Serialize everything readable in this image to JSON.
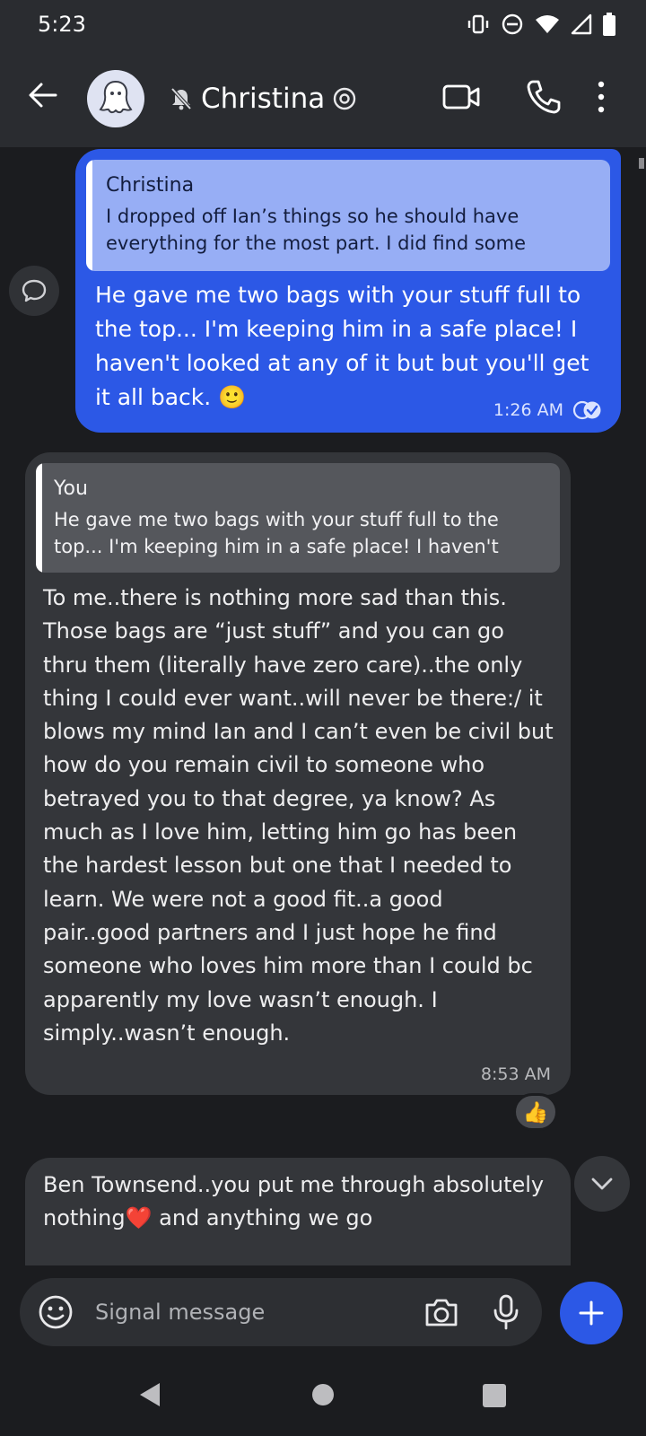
{
  "status_bar": {
    "time": "5:23",
    "icons": [
      "vibrate-icon",
      "dnd-icon",
      "wifi-icon",
      "signal-icon",
      "battery-icon"
    ]
  },
  "header": {
    "contact_name": "Christina",
    "muted": true,
    "icons": [
      "back-arrow-icon",
      "ghost-avatar-icon",
      "bell-off-icon",
      "mention-icon",
      "video-call-icon",
      "phone-icon",
      "more-icon"
    ]
  },
  "messages": [
    {
      "direction": "outgoing",
      "quote": {
        "author": "Christina",
        "text": "I dropped off Ian’s things so he should have everything for the most part. I did find some"
      },
      "text": "He gave me two bags with your stuff full to the top... I'm keeping him in a safe place! I haven't looked at any of it but but you'll get it all back. 🙂",
      "time": "1:26 AM",
      "status": "read"
    },
    {
      "direction": "incoming",
      "quote": {
        "author": "You",
        "text": "He gave me two bags with your stuff full to the top... I'm keeping him in a safe place! I haven't"
      },
      "text": "To me..there is nothing more sad than this. Those bags are “just stuff” and you can go thru them (literally have zero care)..the only thing I could ever want..will never be there:/ it blows my mind Ian and I can’t even be civil but how do you remain civil to someone who betrayed you to that degree, ya know? As much as I love him, letting him go has been the hardest lesson but one that I needed to learn. We were not a good fit..a good pair..good partners and I just hope he find someone who loves him more than I could bc apparently my love wasn’t enough. I simply..wasn’t enough.",
      "time": "8:53 AM",
      "reaction": "👍"
    },
    {
      "direction": "incoming",
      "text": "Ben Townsend..you put me through absolutely nothing❤️ and anything we go"
    }
  ],
  "composer": {
    "placeholder": "Signal message",
    "icons": [
      "emoji-icon",
      "camera-icon",
      "mic-icon",
      "plus-icon"
    ]
  },
  "colors": {
    "outgoing_bubble": "#2c58e6",
    "incoming_bubble": "#34363a",
    "background": "#1b1c1f",
    "header": "#2a2c30"
  }
}
